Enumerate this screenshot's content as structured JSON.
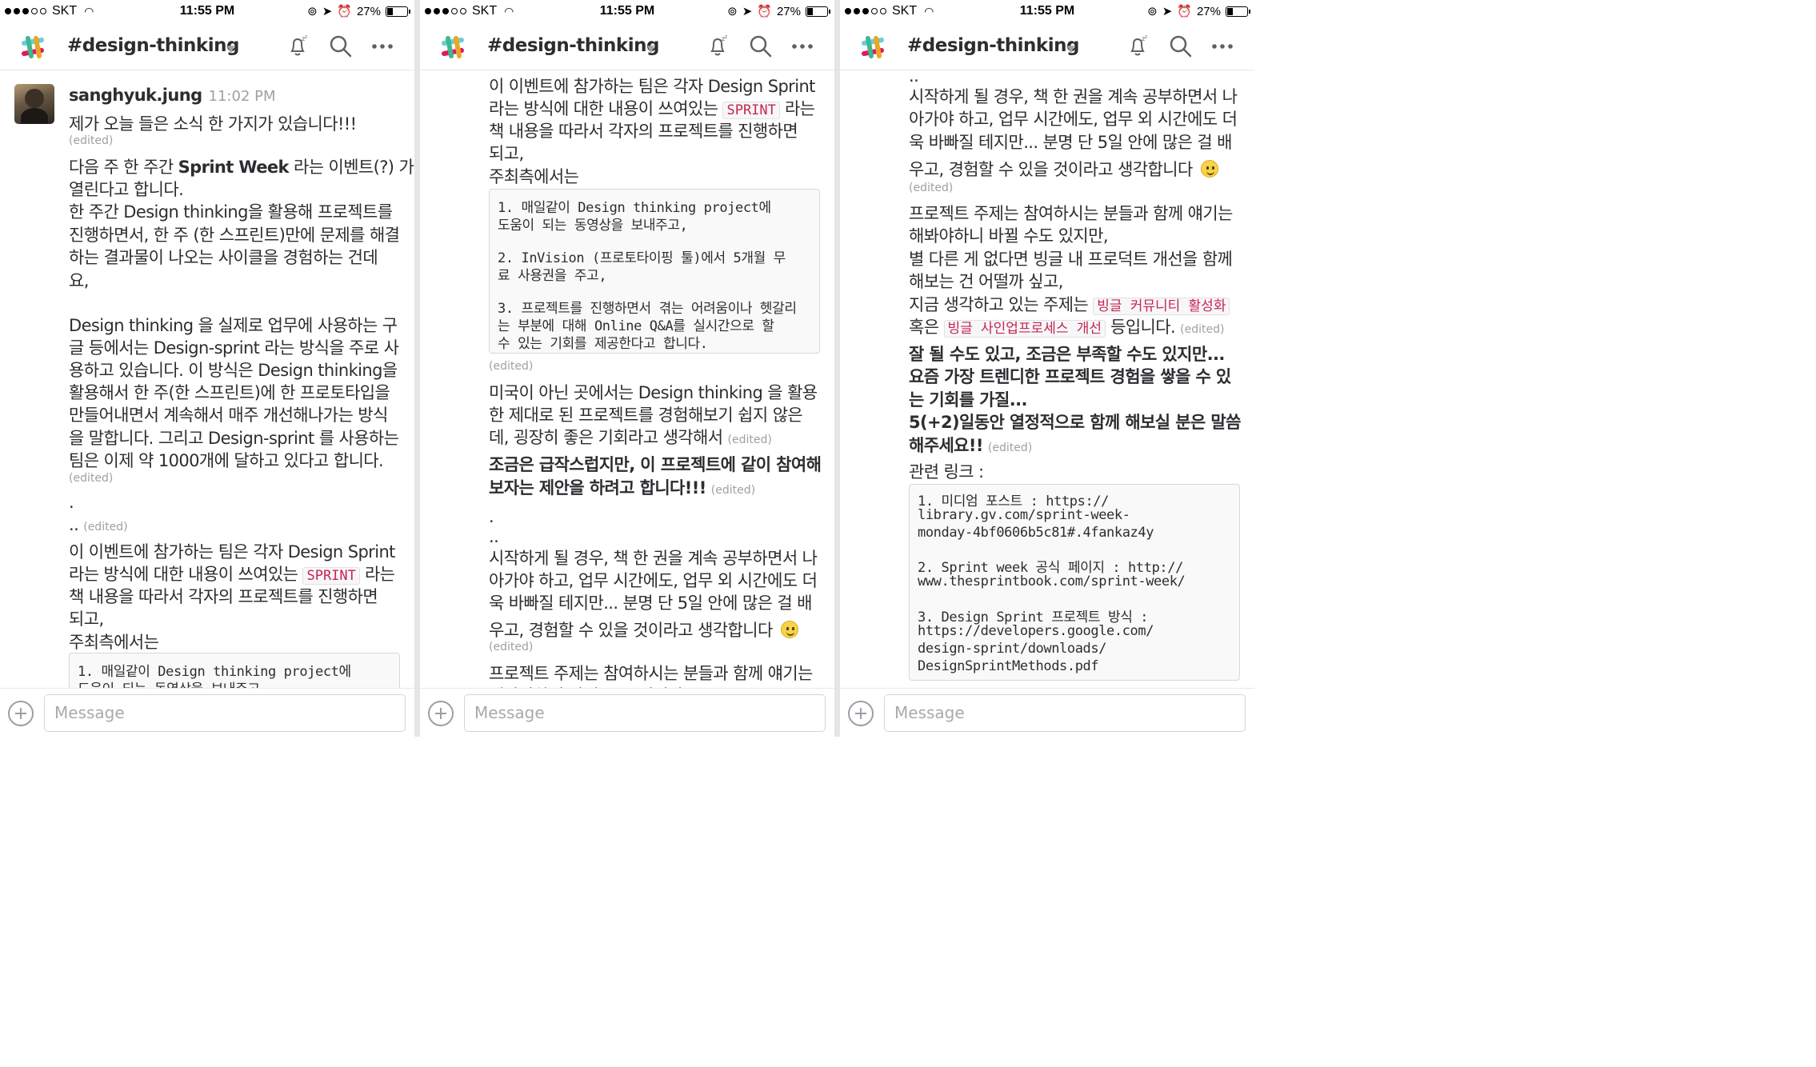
{
  "status": {
    "carrier": "SKT",
    "time": "11:55 PM",
    "battery": "27%",
    "battery_level": 0.27
  },
  "header": {
    "channel": "#design-thinking",
    "dnd_icon": "bell-snooze-icon",
    "search_icon": "search-icon",
    "more_icon": "ellipsis-icon",
    "logo": "slack-logo"
  },
  "message": {
    "author": "sanghyuk.jung",
    "time": "11:02 PM"
  },
  "text": {
    "greet": "제가 오늘 들은 소식 한 가지가 있습니다!!!",
    "edited": "(edited)",
    "a1a": "다음 주 한 주간 ",
    "a1b": "Sprint Week",
    "a1c": " 라는 이벤트(?) 가",
    "a2": "열린다고 합니다.",
    "a3": "한 주간 Design thinking을 활용해 프로젝트를",
    "a4": "진행하면서, 한 주 (한 스프린트)만에 문제를 해결",
    "a5": "하는 결과물이 나오는 사이클을 경험하는 건데",
    "a6": "요,",
    "b1": "Design thinking 을 실제로 업무에 사용하는 구",
    "b2": "글 등에서는 Design-sprint 라는 방식을 주로 사",
    "b3": "용하고 있습니다. 이 방식은 Design thinking을",
    "b4": "활용해서 한 주(한 스프린트)에 한 프로토타입을",
    "b5": "만들어내면서 계속해서 매주 개선해나가는 방식",
    "b6": "을 말합니다. 그리고 Design-sprint 를 사용하는",
    "b7": "팀은 이제 약 1000개에 달하고 있다고 합니다.",
    "dot1": ".",
    "dot2": "..",
    "c1": "이 이벤트에 참가하는 팀은 각자 Design Sprint",
    "c2a": "라는 방식에 대한 내용이 쓰여있는 ",
    "c2code": "SPRINT",
    "c2b": " 라는",
    "c3": "책 내용을 따라서 각자의 프로젝트를 진행하면",
    "c4": "되고,",
    "c5": "주최측에서는",
    "code1": [
      "1. 매일같이 Design thinking project에",
      "도움이 되는 동영상을 보내주고,",
      "",
      "2. InVision (프로토타이핑 툴)에서 5개월 무",
      "료 사용권을 주고,",
      "",
      "3. 프로젝트를 진행하면서 겪는 어려움이나 헷갈리",
      "는 부분에 대해 Online Q&A를 실시간으로 할",
      "수 있는 기회를 제공한다고 합니다."
    ],
    "d1": "미국이 아닌 곳에서는 Design thinking 을 활용",
    "d2": "한 제대로 된 프로젝트를 경험해보기 쉽지 않은",
    "d3": "데, 굉장히 좋은 기회라고 생각해서",
    "e1": "조금은 급작스럽지만, 이 프로젝트에 같이 참여해",
    "e2": "보자는 제안을 하려고 합니다!!!",
    "f1": "시작하게 될 경우, 책 한 권을 계속 공부하면서 나",
    "f2": "아가야 하고, 업무 시간에도, 업무 외 시간에도 더",
    "f3": "욱 바빠질 테지만...  분명 단 5일 안에 많은 걸 배",
    "f4": "우고, 경험할 수 있을 것이라고 생각합니다",
    "smile": "slightly-smiling-face-emoji",
    "g1": "프로젝트 주제는 참여하시는 분들과 함께 얘기는",
    "g2": "해봐야하니 바뀔 수도 있지만,",
    "g3": "별 다른 게 없다면 빙글 내 프로덕트 개선을 함께",
    "g4": "해보는 건 어떨까 싶고,",
    "g5a": "지금 생각하고 있는 주제는 ",
    "g5code": "빙글 커뮤니티 활성화",
    "g6a": "혹은 ",
    "g6code": "빙글 사인업프로세스 개선",
    "g6b": " 등입니다.",
    "h1": "잘 될 수도 있고, 조금은 부족할 수도 있지만...",
    "h2": "요즘 가장 트렌디한 프로젝트 경험을 쌓을 수 있",
    "h3": "는 기회를 가질...",
    "h4": "5(+2)일동안 열정적으로 함께 해보실 분은 말씀",
    "h5": "해주세요!!",
    "links": "관련 링크 :",
    "code2": [
      "1. 미디엄 포스트 : https://",
      "library.gv.com/sprint-week-",
      "monday-4bf0606b5c81#.4fankaz4y",
      "",
      "2. Sprint week 공식 페이지 : http://",
      "www.thesprintbook.com/sprint-week/",
      "",
      "3. Design Sprint 프로젝트 방식 :",
      "https://developers.google.com/",
      "design-sprint/downloads/",
      "DesignSprintMethods.pdf"
    ]
  },
  "composer": {
    "placeholder": "Message",
    "add_icon": "plus-circle-icon"
  },
  "colors": {
    "inline_code": "#c7254e",
    "muted": "#a0a0a2",
    "text": "#2c2d30"
  }
}
